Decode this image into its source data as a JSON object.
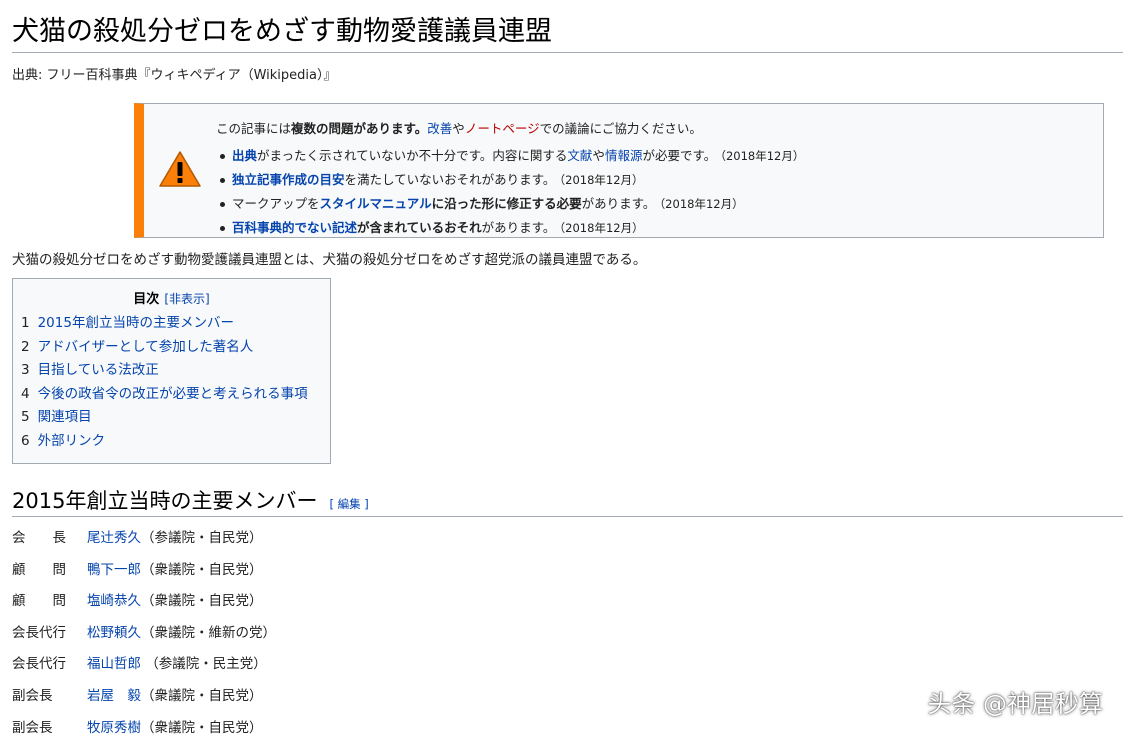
{
  "page": {
    "title": "犬猫の殺処分ゼロをめざす動物愛護議員連盟",
    "source": "出典: フリー百科事典『ウィキペディア（Wikipedia）』"
  },
  "issues_box": {
    "intro_prefix": "この記事には",
    "intro_bold": "複数の問題があります。",
    "intro_link1": "改善",
    "intro_mid": "や",
    "intro_link2": "ノートページ",
    "intro_suffix": "での議論にご協力ください。",
    "items": [
      {
        "link": "出典",
        "text1": "がまったく示されていないか不十分です。内容に関する",
        "link2": "文献",
        "text2": "や",
        "link3": "情報源",
        "text3": "が必要です。",
        "date": "（2018年12月）"
      },
      {
        "link": "独立記事作成の目安",
        "text1": "を満たしていないおそれがあります。",
        "date": "（2018年12月）"
      },
      {
        "text0": "マークアップを",
        "link": "スタイルマニュアル",
        "bold": "に沿った形に修正する必要",
        "text1": "があります。",
        "date": "（2018年12月）"
      },
      {
        "link": "百科事典的でない記述",
        "bold": "が含まれているおそれ",
        "text1": "があります。",
        "date": "（2018年12月）"
      }
    ]
  },
  "intro_paragraph": "犬猫の殺処分ゼロをめざす動物愛護議員連盟とは、犬猫の殺処分ゼロをめざす超党派の議員連盟である。",
  "toc": {
    "title": "目次",
    "toggle": "[非表示]",
    "items": [
      {
        "number": "1",
        "label": "2015年創立当時の主要メンバー"
      },
      {
        "number": "2",
        "label": "アドバイザーとして参加した著名人"
      },
      {
        "number": "3",
        "label": "目指している法改正"
      },
      {
        "number": "4",
        "label": "今後の政省令の改正が必要と考えられる事項"
      },
      {
        "number": "5",
        "label": "関連項目"
      },
      {
        "number": "6",
        "label": "外部リンク"
      }
    ]
  },
  "section": {
    "heading": "2015年創立当時の主要メンバー",
    "edit": "[ 編集 ]"
  },
  "members": [
    {
      "role": "会　　長",
      "name": "尾辻秀久",
      "affiliation": "（参議院・自民党）"
    },
    {
      "role": "顧　　問",
      "name": "鴨下一郎",
      "affiliation": "（衆議院・自民党）"
    },
    {
      "role": "顧　　問",
      "name": "塩崎恭久",
      "affiliation": "（衆議院・自民党）"
    },
    {
      "role": "会長代行",
      "name": "松野頼久",
      "affiliation": "（衆議院・維新の党）"
    },
    {
      "role": "会長代行",
      "name": "福山哲郎",
      "affiliation": " （参議院・民主党）"
    },
    {
      "role": "副会長",
      "name": "岩屋　毅",
      "affiliation": "（衆議院・自民党）"
    },
    {
      "role": "副会長",
      "name": "牧原秀樹",
      "affiliation": "（衆議院・自民党）"
    }
  ],
  "watermark": "头条 @神居秒算",
  "colors": {
    "link": "#0645ad",
    "redlink": "#ba0000",
    "issue_accent": "#fc7f09",
    "box_bg": "#f8f9fa",
    "border": "#a2a9b1"
  },
  "icons": {
    "warning": "warning-triangle-icon"
  }
}
